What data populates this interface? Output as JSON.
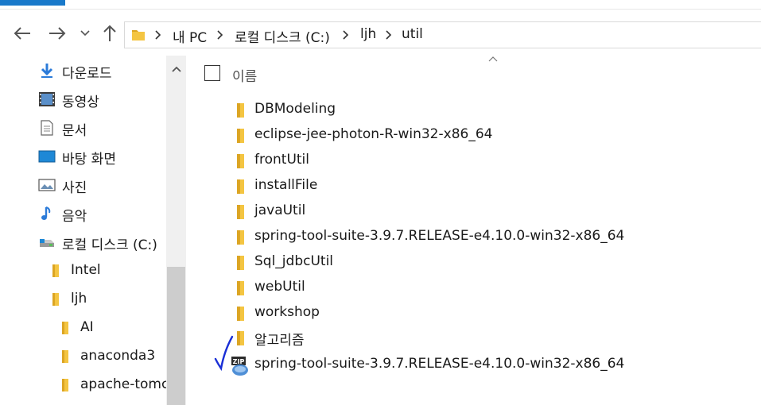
{
  "navbar": {
    "breadcrumbs": [
      "내 PC",
      "로컬 디스크 (C:)",
      "ljh",
      "util"
    ]
  },
  "nav_pane": {
    "items": [
      {
        "label": "다운로드",
        "icon": "download-icon",
        "level": 0
      },
      {
        "label": "동영상",
        "icon": "video-icon",
        "level": 0
      },
      {
        "label": "문서",
        "icon": "document-icon",
        "level": 0
      },
      {
        "label": "바탕 화면",
        "icon": "desktop-icon",
        "level": 0
      },
      {
        "label": "사진",
        "icon": "pictures-icon",
        "level": 0
      },
      {
        "label": "음악",
        "icon": "music-icon",
        "level": 0
      },
      {
        "label": "로컬 디스크 (C:)",
        "icon": "drive-icon",
        "level": 0
      },
      {
        "label": "Intel",
        "icon": "folder-icon",
        "level": 1
      },
      {
        "label": "ljh",
        "icon": "folder-icon",
        "level": 1
      },
      {
        "label": "AI",
        "icon": "folder-icon",
        "level": 2
      },
      {
        "label": "anaconda3",
        "icon": "folder-icon",
        "level": 2
      },
      {
        "label": "apache-tomc",
        "icon": "folder-icon",
        "level": 2
      }
    ]
  },
  "content": {
    "column_name": "이름",
    "files": [
      {
        "name": "DBModeling",
        "type": "folder"
      },
      {
        "name": "eclipse-jee-photon-R-win32-x86_64",
        "type": "folder"
      },
      {
        "name": "frontUtil",
        "type": "folder"
      },
      {
        "name": "installFile",
        "type": "folder"
      },
      {
        "name": "javaUtil",
        "type": "folder"
      },
      {
        "name": "spring-tool-suite-3.9.7.RELEASE-e4.10.0-win32-x86_64",
        "type": "folder"
      },
      {
        "name": "Sql_jdbcUtil",
        "type": "folder"
      },
      {
        "name": "webUtil",
        "type": "folder"
      },
      {
        "name": "workshop",
        "type": "folder"
      },
      {
        "name": "알고리즘",
        "type": "folder"
      },
      {
        "name": "spring-tool-suite-3.9.7.RELEASE-e4.10.0-win32-x86_64",
        "type": "zip"
      }
    ]
  },
  "colors": {
    "accent": "#1979ca",
    "folder": "#f4c542",
    "folder_dark": "#dca523",
    "annotation": "#1a2fd6"
  }
}
